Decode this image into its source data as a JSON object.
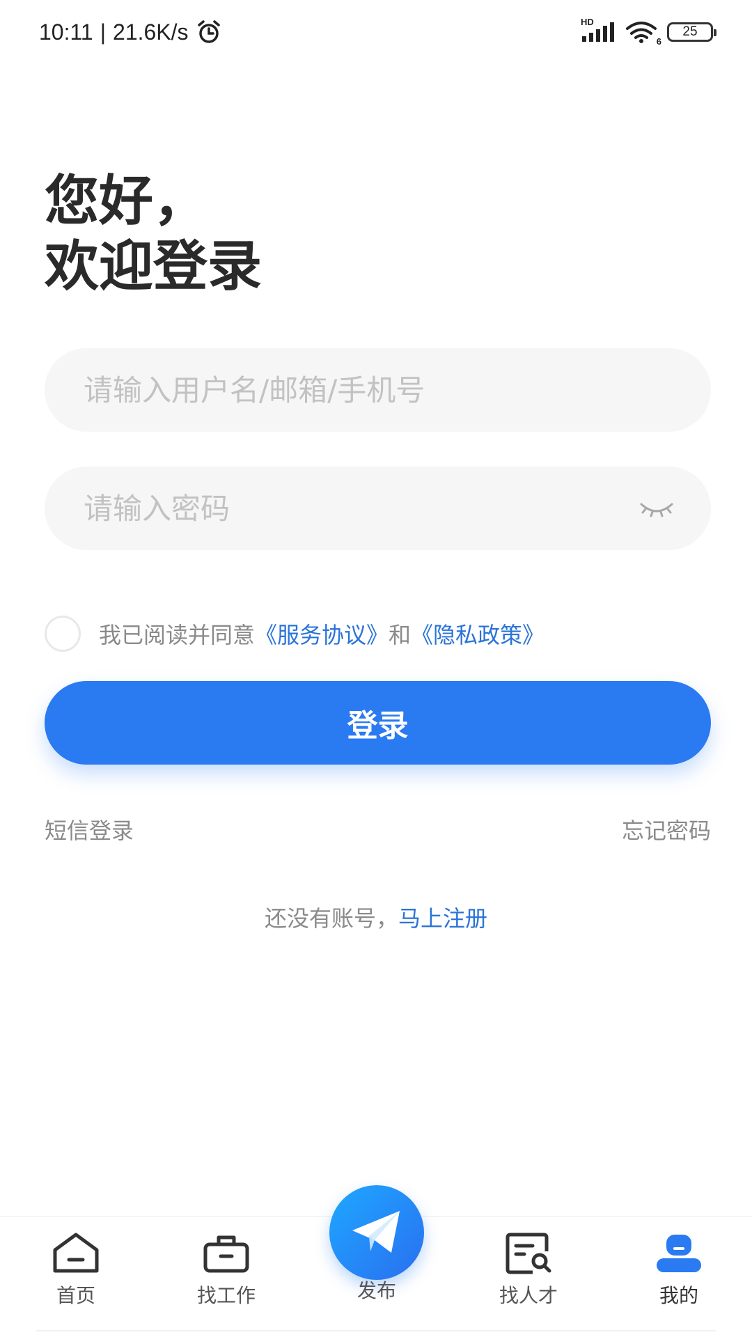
{
  "status_bar": {
    "time": "10:11",
    "separator": "|",
    "net_speed": "21.6K/s",
    "alarm_icon": "alarm-clock-icon",
    "hd_label": "HD",
    "signal_icon": "cellular-signal-icon",
    "wifi_icon": "wifi-icon",
    "wifi_badge": "6",
    "battery_level": "25"
  },
  "greeting": {
    "line1": "您好，",
    "line2": "欢迎登录"
  },
  "form": {
    "username_placeholder": "请输入用户名/邮箱/手机号",
    "password_placeholder": "请输入密码",
    "password_visibility_icon": "eye-closed-icon"
  },
  "agreement": {
    "prefix": "我已阅读并同意",
    "service_link": "《服务协议》",
    "and": "和",
    "privacy_link": "《隐私政策》",
    "checked": false
  },
  "login_button": "登录",
  "links": {
    "sms_login": "短信登录",
    "forgot_password": "忘记密码",
    "no_account": "还没有账号，",
    "register_now": "马上注册"
  },
  "bottom_nav": {
    "items": [
      {
        "label": "首页",
        "icon": "home-icon"
      },
      {
        "label": "找工作",
        "icon": "briefcase-icon"
      },
      {
        "label": "发布",
        "icon": "paper-plane-icon"
      },
      {
        "label": "找人才",
        "icon": "resume-search-icon"
      },
      {
        "label": "我的",
        "icon": "profile-icon"
      }
    ],
    "active_index": 4
  },
  "colors": {
    "accent": "#2a7af2",
    "link": "#2a74d8",
    "input_bg": "#f6f6f6",
    "muted_text": "#8a8a8a"
  }
}
